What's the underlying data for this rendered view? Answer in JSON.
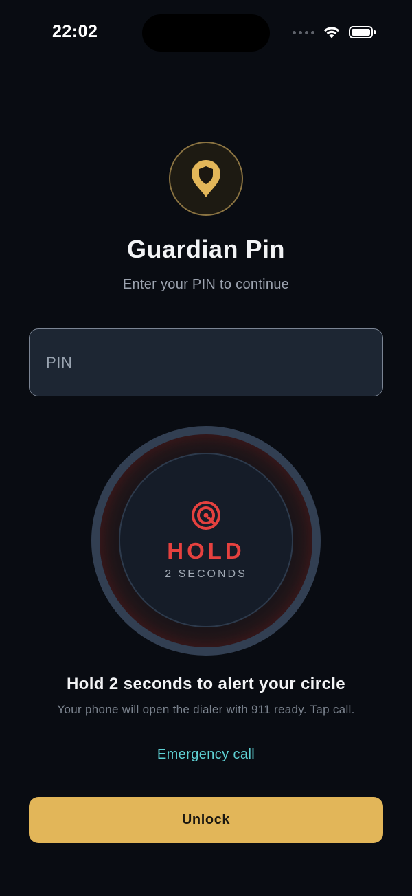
{
  "status_bar": {
    "time": "22:02"
  },
  "header": {
    "title": "Guardian Pin",
    "subtitle": "Enter your PIN to continue"
  },
  "pin_input": {
    "placeholder": "PIN",
    "value": ""
  },
  "hold_button": {
    "label": "HOLD",
    "sublabel": "2 SECONDS"
  },
  "info": {
    "title": "Hold 2 seconds to alert your circle",
    "description": "Your phone will open the dialer with 911 ready. Tap call."
  },
  "emergency_link": "Emergency call",
  "unlock_button": "Unlock",
  "icons": {
    "logo": "shield-pin-icon",
    "hold": "target-icon",
    "wifi": "wifi-icon",
    "battery": "battery-icon",
    "signal": "signal-icon"
  },
  "colors": {
    "background": "#090c12",
    "accent_gold": "#e2b659",
    "alert_red": "#e5413f",
    "link_teal": "#5ed0d3"
  }
}
